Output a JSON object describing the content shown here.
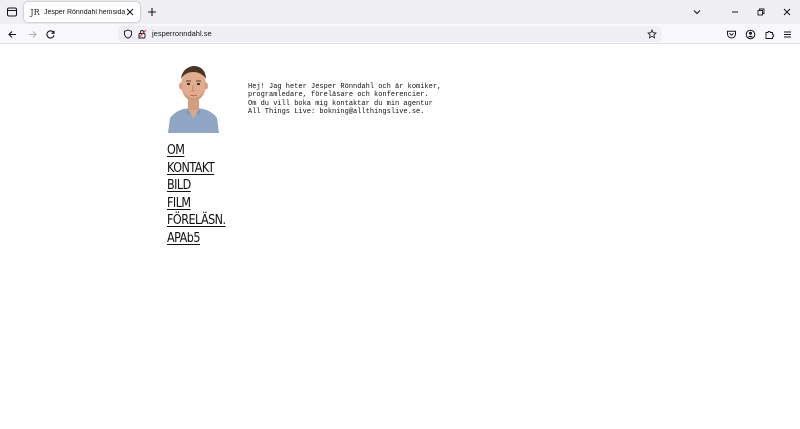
{
  "browser": {
    "tab": {
      "title": "Jesper Rönndahl hemsida",
      "favicon": "JR"
    },
    "url": "jesperronndahl.se"
  },
  "page": {
    "intro_lines": [
      "Hej! Jag heter Jesper Rönndahl och är komiker,",
      "programledare, föreläsare och konferencier.",
      "Om du vill boka mig kontaktar du min agentur",
      "All Things Live: bokning@allthingslive.se."
    ],
    "menu": [
      {
        "label": "OM"
      },
      {
        "label": "KONTAKT"
      },
      {
        "label": "BILD"
      },
      {
        "label": "FILM"
      },
      {
        "label": "FÖRELÄSN."
      },
      {
        "label": "APAb5"
      }
    ]
  },
  "colors": {
    "chrome": "#f0f0f4",
    "toolbar": "#f9f9fb",
    "page_bg": "#ffffff",
    "text": "#111111"
  }
}
